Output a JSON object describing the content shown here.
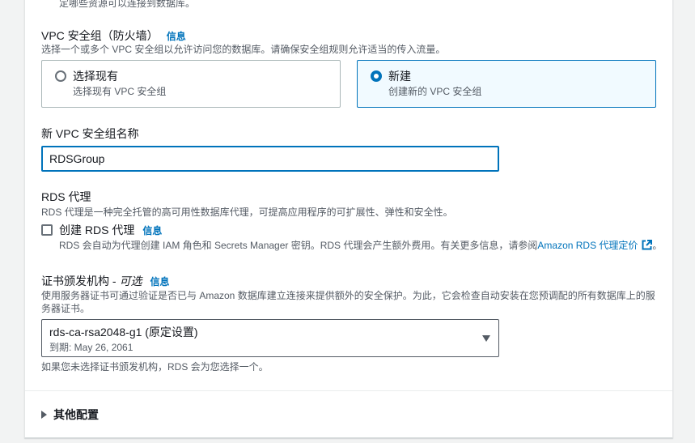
{
  "top_desc_cut": "定哪些资源可以连接到数据库。",
  "vpc_sg": {
    "title": "VPC 安全组（防火墙）",
    "info": "信息",
    "description": "选择一个或多个 VPC 安全组以允许访问您的数据库。请确保安全组规则允许适当的传入流量。",
    "options": [
      {
        "title": "选择现有",
        "desc": "选择现有 VPC 安全组",
        "selected": false
      },
      {
        "title": "新建",
        "desc": "创建新的 VPC 安全组",
        "selected": true
      }
    ]
  },
  "new_sg_name": {
    "label": "新 VPC 安全组名称",
    "value": "RDSGroup"
  },
  "rds_proxy": {
    "title": "RDS 代理",
    "description": "RDS 代理是一种完全托管的高可用性数据库代理，可提高应用程序的可扩展性、弹性和安全性。",
    "checkbox_label": "创建 RDS 代理",
    "info": "信息",
    "checked": false,
    "checkbox_desc": "RDS 会自动为代理创建 IAM 角色和 Secrets Manager 密钥。RDS 代理会产生额外费用。有关更多信息，请参阅",
    "link_text": "Amazon RDS 代理定价",
    "period": "。"
  },
  "cert_authority": {
    "title": "证书颁发机构 - ",
    "optional": "可选",
    "info": "信息",
    "description": "使用服务器证书可通过验证是否已与 Amazon 数据库建立连接来提供额外的安全保护。为此，它会检查自动安装在您预调配的所有数据库上的服务器证书。",
    "selected_value": "rds-ca-rsa2048-g1 (原定设置)",
    "selected_sub": "到期: May 26, 2061",
    "footnote": "如果您未选择证书颁发机构，RDS 会为您选择一个。"
  },
  "additional_config": {
    "label": "其他配置"
  },
  "colors": {
    "accent": "#0073bb",
    "selected_bg": "#f1faff",
    "text": "#16191f",
    "muted": "#545b64"
  },
  "icons": [
    "caret-down-icon",
    "caret-right-icon",
    "external-link-icon"
  ]
}
